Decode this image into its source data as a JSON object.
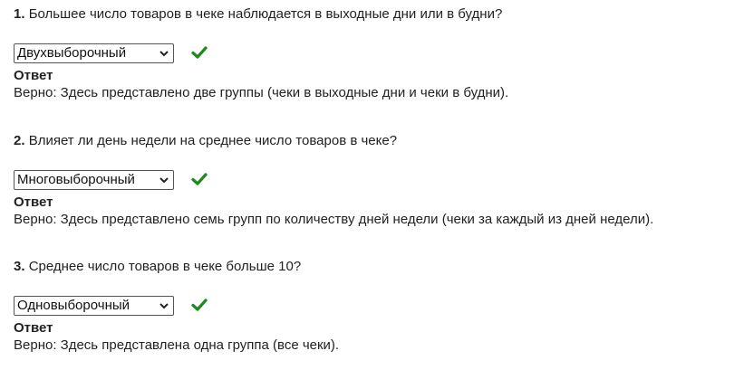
{
  "accent_check_color": "#1e8a1e",
  "questions": [
    {
      "number": "1.",
      "text": "Большее число товаров в чеке наблюдается в выходные дни или в будни?",
      "selected": "Двухвыборочный",
      "answer_label": "Ответ",
      "feedback": "Верно:  Здесь представлено две группы (чеки в выходные дни и чеки в будни)."
    },
    {
      "number": "2.",
      "text": "Влияет ли день недели на среднее число товаров в чеке?",
      "selected": "Многовыборочный",
      "answer_label": "Ответ",
      "feedback": "Верно:  Здесь представлено семь групп по количеству дней недели (чеки за каждый из дней недели)."
    },
    {
      "number": "3.",
      "text": "Среднее число товаров в чеке больше 10?",
      "selected": "Одновыборочный",
      "answer_label": "Ответ",
      "feedback": "Верно:  Здесь представлена одна группа (все чеки)."
    }
  ]
}
